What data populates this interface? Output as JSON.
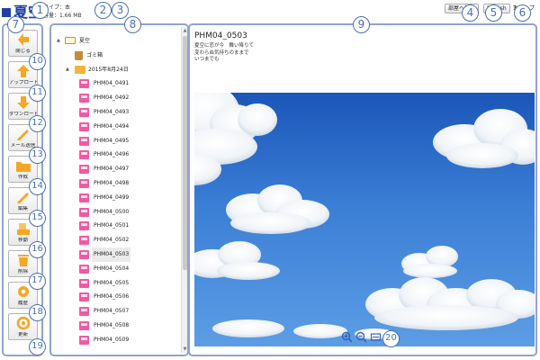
{
  "header": {
    "title": "夏空",
    "type_line": "タイプ：本",
    "size_line": "容量：1.66 MB",
    "move_button": "部屋へ移動",
    "english_button": "English",
    "help_link": "ヘルプ",
    "help_icon": "?"
  },
  "callouts": [
    "1",
    "2",
    "3",
    "4",
    "5",
    "6",
    "7",
    "8",
    "9",
    "10",
    "11",
    "12",
    "13",
    "14",
    "15",
    "16",
    "17",
    "18",
    "19",
    "20"
  ],
  "toolbar": {
    "buttons": [
      {
        "label": "閉じる",
        "icon": "close-arrow-icon",
        "color": "#f5a623"
      },
      {
        "label": "アップロード",
        "icon": "upload-icon",
        "color": "#f5a623"
      },
      {
        "label": "ダウンロード",
        "icon": "download-icon",
        "color": "#f5a623"
      },
      {
        "label": "メール送信",
        "icon": "pencil-mail-icon",
        "color": "#f5a623"
      },
      {
        "label": "作成",
        "icon": "folder-create-icon",
        "color": "#f5a623"
      },
      {
        "label": "編集",
        "icon": "pencil-icon",
        "color": "#f5a623"
      },
      {
        "label": "移動",
        "icon": "move-icon",
        "color": "#f5a623"
      },
      {
        "label": "削除",
        "icon": "trash-icon",
        "color": "#f5a623"
      },
      {
        "label": "履歴",
        "icon": "gear-icon",
        "color": "#f5a623"
      },
      {
        "label": "更新",
        "icon": "refresh-icon",
        "color": "#f5a623"
      }
    ],
    "dropdown_arrow": "▼"
  },
  "tree": {
    "root": "夏空",
    "trash": "ゴミ箱",
    "folder": "2015年8月24日",
    "files": [
      "PHM04_0491",
      "PHM04_0492",
      "PHM04_0493",
      "PHM04_0494",
      "PHM04_0495",
      "PHM04_0496",
      "PHM04_0497",
      "PHM04_0498",
      "PHM04_0499",
      "PHM04_0500",
      "PHM04_0501",
      "PHM04_0502",
      "PHM04_0503",
      "PHM04_0504",
      "PHM04_0505",
      "PHM04_0506",
      "PHM04_0507",
      "PHM04_0508",
      "PHM04_0509"
    ],
    "selected": "PHM04_0503",
    "expand_glyph": "▲"
  },
  "preview": {
    "title": "PHM04_0503",
    "lines": [
      "夏空に恋が今　舞い降りて",
      "変わらぬ気持ちのままで",
      "いつまでも"
    ],
    "zoom_in": "+",
    "zoom_out": "−",
    "fit": "⇔"
  }
}
